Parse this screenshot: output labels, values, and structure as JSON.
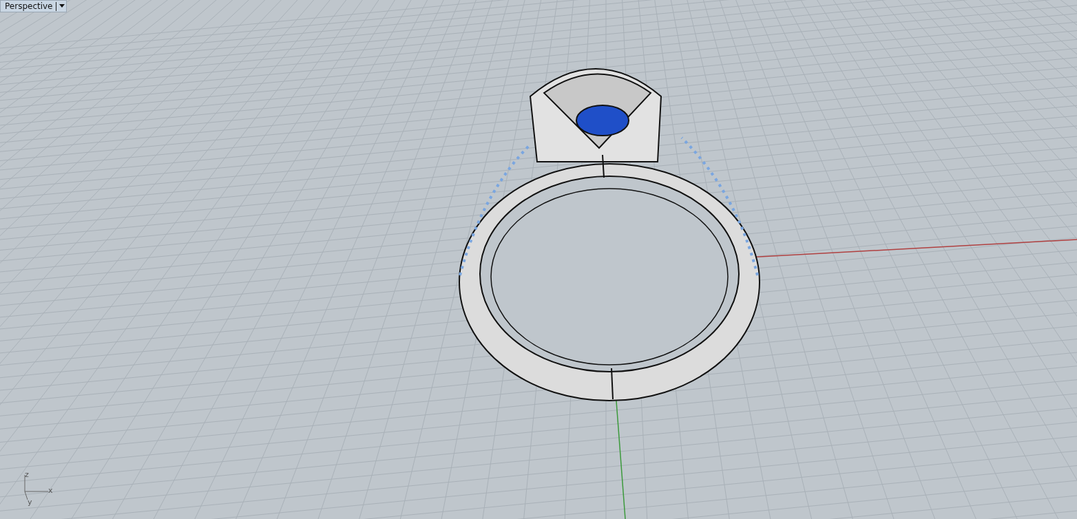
{
  "viewport": {
    "title": "Perspective",
    "axis_labels": [
      "z",
      "x",
      "y"
    ]
  }
}
